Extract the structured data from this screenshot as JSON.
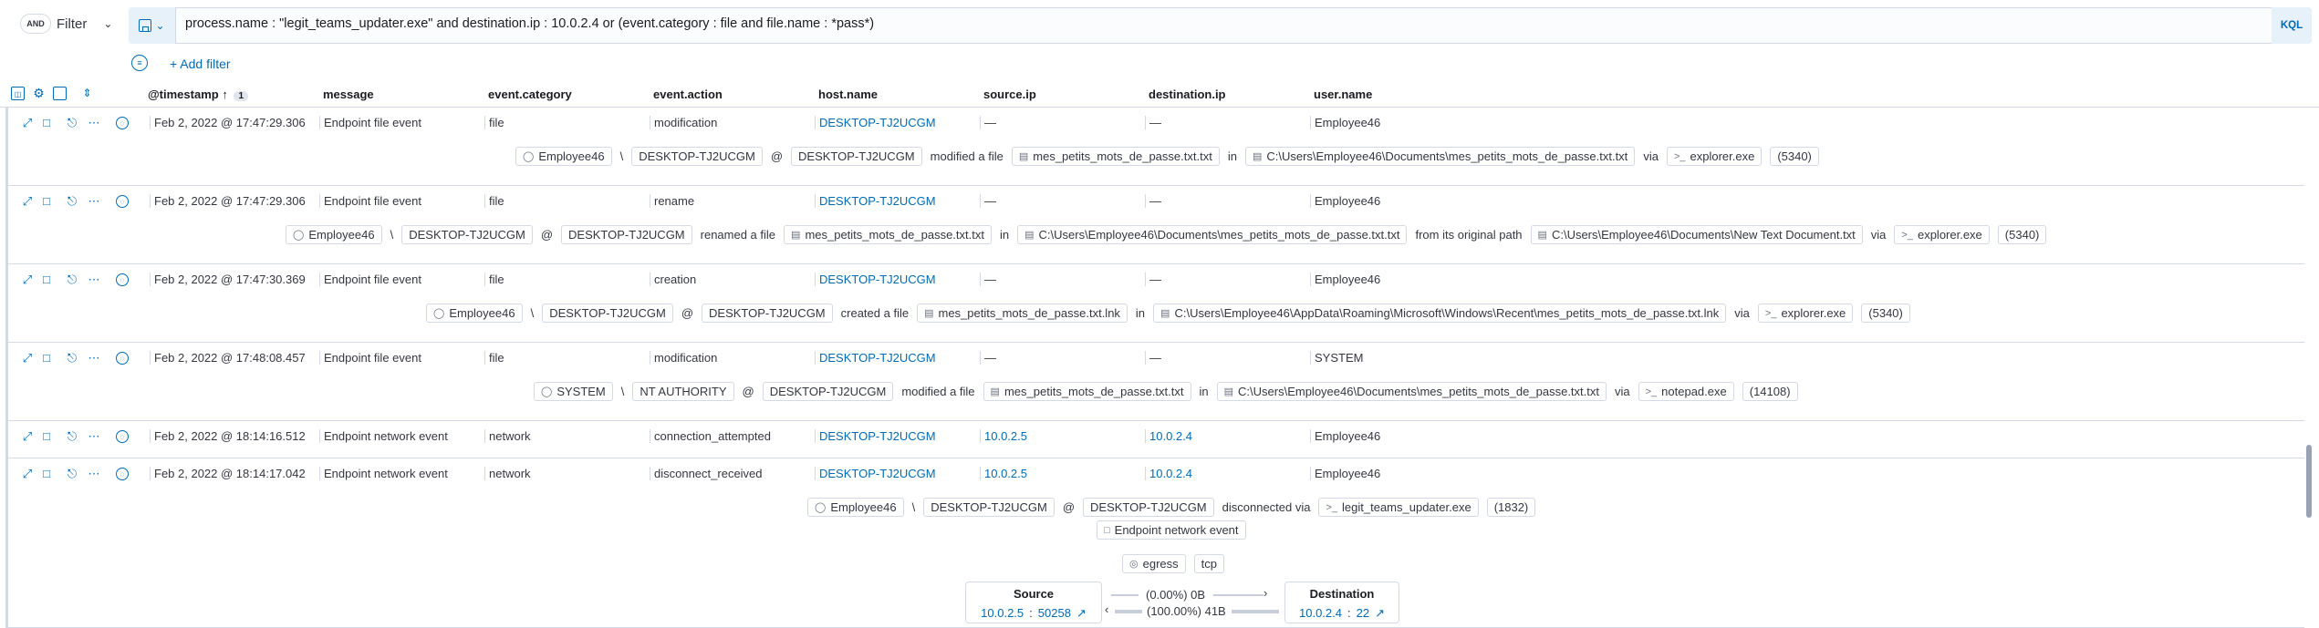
{
  "query_bar": {
    "and_label": "AND",
    "filter_label": "Filter",
    "query": "process.name : \"legit_teams_updater.exe\" and destination.ip : 10.0.2.4 or (event.category : file and file.name : *pass*)",
    "language": "KQL",
    "add_filter": "+ Add filter"
  },
  "columns": {
    "timestamp": "@timestamp",
    "sort_count": "1",
    "message": "message",
    "event_category": "event.category",
    "event_action": "event.action",
    "host_name": "host.name",
    "source_ip": "source.ip",
    "destination_ip": "destination.ip",
    "user_name": "user.name"
  },
  "rows": [
    {
      "timestamp": "Feb 2, 2022 @ 17:47:29.306",
      "message": "Endpoint file event",
      "category": "file",
      "action": "modification",
      "host": "DESKTOP-TJ2UCGM",
      "source_ip": "—",
      "destination_ip": "—",
      "user": "Employee46",
      "summary": {
        "user": "Employee46",
        "domain": "DESKTOP-TJ2UCGM",
        "host": "DESKTOP-TJ2UCGM",
        "verb": "modified a file",
        "file": "mes_petits_mots_de_passe.txt.txt",
        "in": "in",
        "path": "C:\\Users\\Employee46\\Documents\\mes_petits_mots_de_passe.txt.txt",
        "via": "via",
        "process": "explorer.exe",
        "pid": "(5340)"
      }
    },
    {
      "timestamp": "Feb 2, 2022 @ 17:47:29.306",
      "message": "Endpoint file event",
      "category": "file",
      "action": "rename",
      "host": "DESKTOP-TJ2UCGM",
      "source_ip": "—",
      "destination_ip": "—",
      "user": "Employee46",
      "summary": {
        "user": "Employee46",
        "domain": "DESKTOP-TJ2UCGM",
        "host": "DESKTOP-TJ2UCGM",
        "verb": "renamed a file",
        "file": "mes_petits_mots_de_passe.txt.txt",
        "in": "in",
        "path": "C:\\Users\\Employee46\\Documents\\mes_petits_mots_de_passe.txt.txt",
        "orig_label": "from its original path",
        "orig_path": "C:\\Users\\Employee46\\Documents\\New Text Document.txt",
        "via": "via",
        "process": "explorer.exe",
        "pid": "(5340)"
      }
    },
    {
      "timestamp": "Feb 2, 2022 @ 17:47:30.369",
      "message": "Endpoint file event",
      "category": "file",
      "action": "creation",
      "host": "DESKTOP-TJ2UCGM",
      "source_ip": "—",
      "destination_ip": "—",
      "user": "Employee46",
      "summary": {
        "user": "Employee46",
        "domain": "DESKTOP-TJ2UCGM",
        "host": "DESKTOP-TJ2UCGM",
        "verb": "created a file",
        "file": "mes_petits_mots_de_passe.txt.lnk",
        "in": "in",
        "path": "C:\\Users\\Employee46\\AppData\\Roaming\\Microsoft\\Windows\\Recent\\mes_petits_mots_de_passe.txt.lnk",
        "via": "via",
        "process": "explorer.exe",
        "pid": "(5340)"
      }
    },
    {
      "timestamp": "Feb 2, 2022 @ 17:48:08.457",
      "message": "Endpoint file event",
      "category": "file",
      "action": "modification",
      "host": "DESKTOP-TJ2UCGM",
      "source_ip": "—",
      "destination_ip": "—",
      "user": "SYSTEM",
      "summary": {
        "user": "SYSTEM",
        "domain": "NT AUTHORITY",
        "host": "DESKTOP-TJ2UCGM",
        "verb": "modified a file",
        "file": "mes_petits_mots_de_passe.txt.txt",
        "in": "in",
        "path": "C:\\Users\\Employee46\\Documents\\mes_petits_mots_de_passe.txt.txt",
        "via": "via",
        "process": "notepad.exe",
        "pid": "(14108)"
      }
    },
    {
      "timestamp": "Feb 2, 2022 @ 18:14:16.512",
      "message": "Endpoint network event",
      "category": "network",
      "action": "connection_attempted",
      "host": "DESKTOP-TJ2UCGM",
      "source_ip": "10.0.2.5",
      "destination_ip": "10.0.2.4",
      "user": "Employee46"
    },
    {
      "timestamp": "Feb 2, 2022 @ 18:14:17.042",
      "message": "Endpoint network event",
      "category": "network",
      "action": "disconnect_received",
      "host": "DESKTOP-TJ2UCGM",
      "source_ip": "10.0.2.5",
      "destination_ip": "10.0.2.4",
      "user": "Employee46",
      "summary": {
        "user": "Employee46",
        "domain": "DESKTOP-TJ2UCGM",
        "host": "DESKTOP-TJ2UCGM",
        "verb": "disconnected via",
        "process": "legit_teams_updater.exe",
        "pid": "(1832)",
        "event_badge": "Endpoint network event",
        "direction": "egress",
        "transport": "tcp"
      },
      "network": {
        "source_title": "Source",
        "source_ip": "10.0.2.5",
        "source_port": "50258",
        "dest_title": "Destination",
        "dest_ip": "10.0.2.4",
        "dest_port": "22",
        "out_bytes": "(0.00%) 0B",
        "in_bytes": "(100.00%) 41B"
      }
    }
  ],
  "colors": {
    "link": "#006bb4",
    "border": "#d3dae6",
    "text": "#343741"
  }
}
